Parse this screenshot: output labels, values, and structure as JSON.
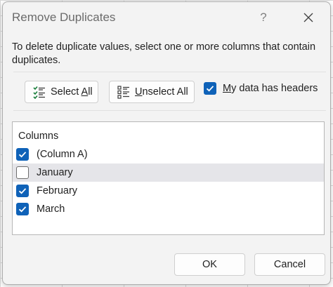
{
  "dialog": {
    "title": "Remove Duplicates",
    "help_label": "?",
    "instructions": "To delete duplicate values, select one or more columns that contain duplicates."
  },
  "toolbar": {
    "select_all": {
      "text": "Select ",
      "hotkey": "A",
      "rest": "ll"
    },
    "unselect_all": {
      "hotkey": "U",
      "rest": "nselect All"
    },
    "my_data_has_headers": {
      "hotkey": "M",
      "rest": "y data has headers",
      "checked": true
    }
  },
  "columns": {
    "header": "Columns",
    "items": [
      {
        "label": "(Column A)",
        "checked": true
      },
      {
        "label": "January",
        "checked": false
      },
      {
        "label": "February",
        "checked": true
      },
      {
        "label": "March",
        "checked": true
      }
    ]
  },
  "footer": {
    "ok_label": "OK",
    "cancel_label": "Cancel"
  },
  "colors": {
    "accent": "#0f62b8",
    "dialog_bg": "#f3f3f3",
    "row_highlight": "#e5e5e9"
  },
  "icons": {
    "select_all": "select-all-list-icon",
    "unselect_all": "unselect-all-list-icon",
    "help": "help-icon",
    "close": "close-icon",
    "checkmark": "checkmark-icon"
  }
}
